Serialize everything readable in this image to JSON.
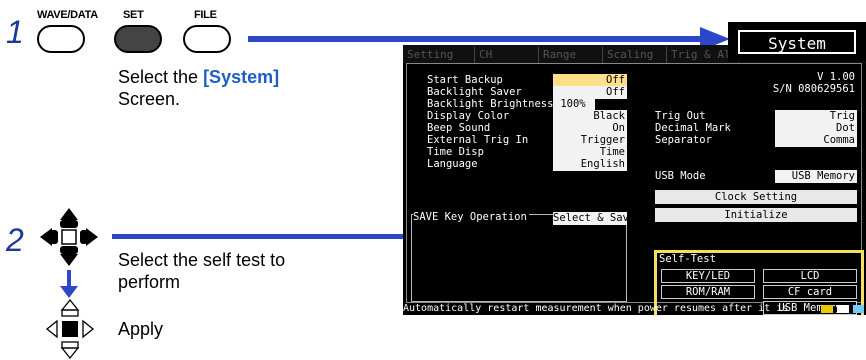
{
  "step1": {
    "number": "1",
    "instruction_pre": "Select the ",
    "instruction_hl": "[System]",
    "instruction_post": "Screen."
  },
  "step2": {
    "number": "2",
    "instruction": "Select the self test to perform",
    "apply": "Apply"
  },
  "keys": {
    "wave_data": "WAVE/DATA",
    "set": "SET",
    "file": "FILE"
  },
  "screen": {
    "tabs": [
      "Setting",
      "CH",
      "Range",
      "Scaling",
      "Trig & Alm"
    ],
    "system_title": "System",
    "version": "V 1.00",
    "serial": "S/N 080629561",
    "left_settings": [
      {
        "label": "Start Backup",
        "value": "Off"
      },
      {
        "label": "Backlight Saver",
        "value": "Off"
      },
      {
        "label": "Backlight Brightness",
        "value": "100%"
      },
      {
        "label": "Display Color",
        "value": "Black"
      },
      {
        "label": "Beep Sound",
        "value": "On"
      },
      {
        "label": "External Trig In",
        "value": "Trigger"
      },
      {
        "label": "Time Disp",
        "value": "Time"
      },
      {
        "label": "Language",
        "value": "English"
      }
    ],
    "right_settings": [
      {
        "label": "Trig Out",
        "value": "Trig"
      },
      {
        "label": "Decimal Mark",
        "value": "Dot"
      },
      {
        "label": "Separator",
        "value": "Comma"
      }
    ],
    "usb_mode": {
      "label": "USB Mode",
      "value": "USB Memory"
    },
    "clock_setting": "Clock Setting",
    "initialize": "Initialize",
    "save_key": {
      "label": "SAVE Key Operation",
      "value": "Select & Save"
    },
    "self_test": {
      "title": "Self-Test",
      "buttons": [
        "KEY/LED",
        "LCD",
        "ROM/RAM",
        "CF card",
        "USB Memory"
      ]
    },
    "status": "Automatically restart measurement when power resumes after it is"
  },
  "colors": {
    "accent": "#2c47c8",
    "highlight_text": "#1e5ec8",
    "selftest_border": "#f4e05a",
    "selected_value": "#ffe08a"
  }
}
